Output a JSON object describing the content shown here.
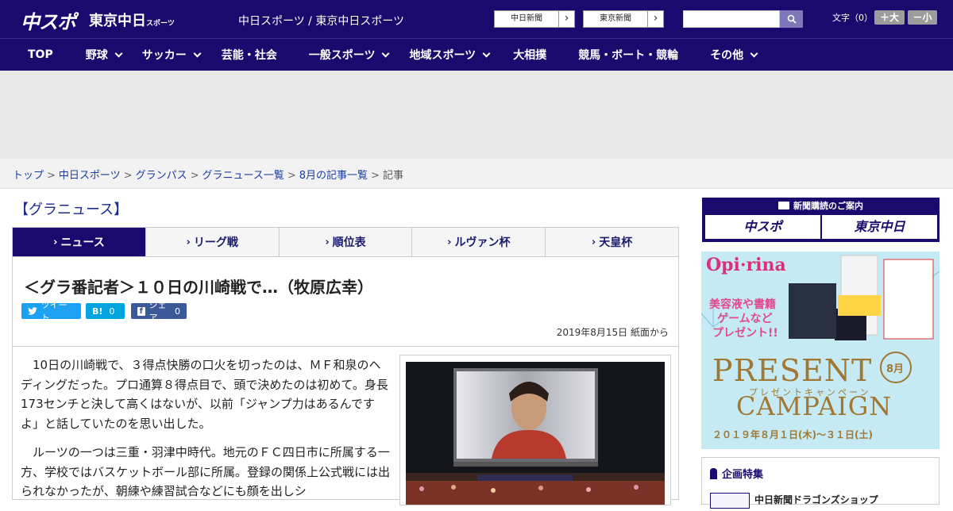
{
  "header": {
    "logo_main": "中スポ",
    "logo_sub": "東京中日",
    "logo_sub_small": "スポーツ",
    "site_name": "中日スポーツ / 東京中日スポーツ",
    "ext_links": [
      "中日新聞",
      "東京新聞"
    ],
    "font_label": "文字（0）",
    "size_up": "＋大",
    "size_down": "－小"
  },
  "nav": {
    "items": [
      {
        "label": "TOP",
        "dropdown": false
      },
      {
        "label": "野球",
        "dropdown": true
      },
      {
        "label": "サッカー",
        "dropdown": true
      },
      {
        "label": "芸能・社会",
        "dropdown": false
      },
      {
        "label": "一般スポーツ",
        "dropdown": true
      },
      {
        "label": "地域スポーツ",
        "dropdown": true
      },
      {
        "label": "大相撲",
        "dropdown": false
      },
      {
        "label": "競馬・ボート・競輪",
        "dropdown": false
      },
      {
        "label": "その他",
        "dropdown": true
      }
    ]
  },
  "breadcrumb": {
    "items": [
      "トップ",
      "中日スポーツ",
      "グランパス",
      "グラニュース一覧",
      "8月の記事一覧"
    ],
    "current": "記事",
    "separator": ">"
  },
  "section": {
    "title": "【グラニュース】"
  },
  "tabs": [
    "ニュース",
    "リーグ戦",
    "順位表",
    "ルヴァン杯",
    "天皇杯"
  ],
  "article": {
    "headline": "＜グラ番記者＞１０日の川崎戦で…（牧原広幸）",
    "share": {
      "tweet": "ツイート",
      "hatena_label": "B!",
      "hatena_count": "0",
      "facebook": "シェア",
      "facebook_count": "0"
    },
    "date": "2019年8月15日 紙面から",
    "paragraphs": [
      "10日の川崎戦で、３得点快勝の口火を切ったのは、ＭＦ和泉のヘディングだった。プロ通算８得点目で、頭で決めたのは初めて。身長173センチと決して高くはないが、以前「ジャンプ力はあるんですよ」と話していたのを思い出した。",
      "ルーツの一つは三重・羽津中時代。地元のＦＣ四日市に所属する一方、学校ではバスケットボール部に所属。登録の関係上公式戦には出られなかったが、朝練や練習試合などにも顔を出しシ"
    ]
  },
  "sidebar": {
    "subscribe_head": "新聞購読のご案内",
    "subscribe_left": "中スポ",
    "subscribe_right": "東京中日",
    "promo_brand": "Opi·rina",
    "promo_line1": "美容液や書籍",
    "promo_line2": "ゲームなど",
    "promo_line3": "プレゼント!!",
    "promo_month": "8月",
    "promo_title1": "PRESENT",
    "promo_title_jp": "プレゼントキャンペーン",
    "promo_title2": "CAMPAIGN",
    "promo_dates": "２０１９年８月１日(木)～３１日(土)",
    "feature_head": "企画特集",
    "feature_item": "中日新聞ドラゴンズショップ"
  },
  "colors": {
    "brand": "#1b0a6e",
    "link": "#1b3c9e",
    "twitter": "#1da1f2",
    "hatena": "#00a4de",
    "facebook": "#3b5998"
  }
}
